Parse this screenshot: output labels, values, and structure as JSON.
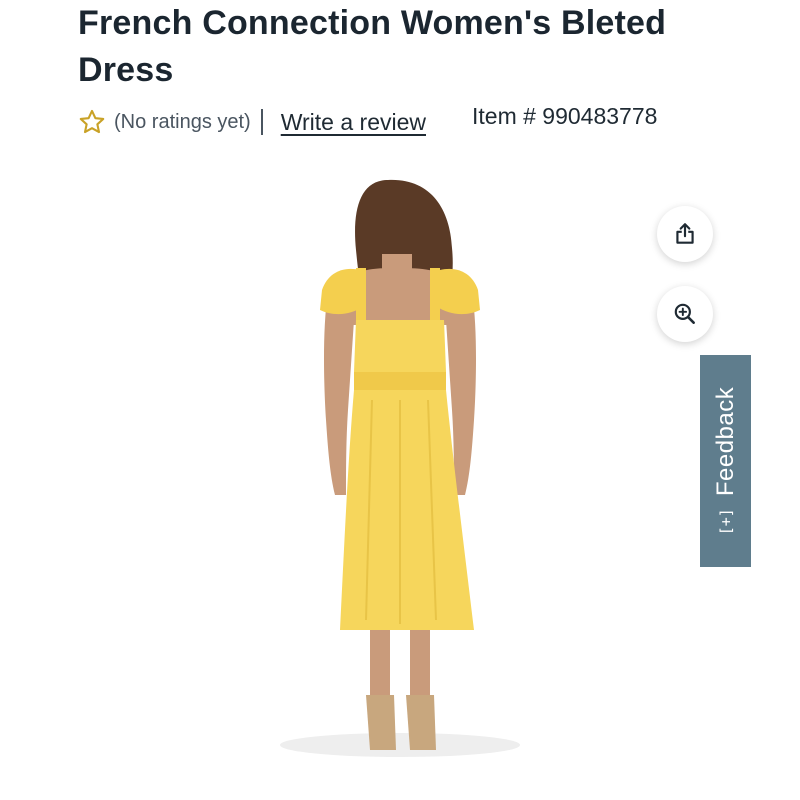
{
  "product": {
    "title": "French Connection Women's Bleted Dress",
    "ratings_text": "(No ratings yet)",
    "write_review_label": "Write a review",
    "item_number": "Item # 990483778"
  },
  "icons": {
    "rating_star": "star-outline-icon",
    "share": "share-icon",
    "zoom": "zoom-in-icon"
  },
  "feedback": {
    "label": "Feedback",
    "plus": "[+]"
  },
  "colors": {
    "title_text": "#1b2630",
    "star_gold": "#c9a227",
    "feedback_bg": "#5f7d8d",
    "dress_yellow": "#f6d65c"
  }
}
